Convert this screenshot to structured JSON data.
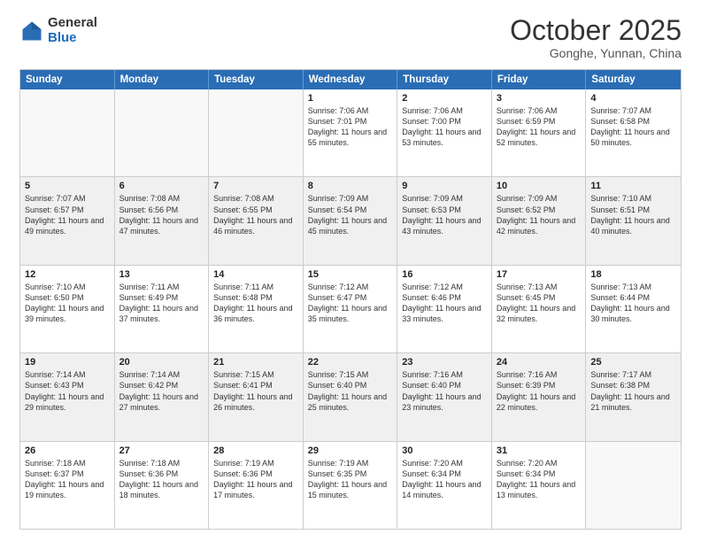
{
  "header": {
    "logo_general": "General",
    "logo_blue": "Blue",
    "month_title": "October 2025",
    "location": "Gonghe, Yunnan, China"
  },
  "days_of_week": [
    "Sunday",
    "Monday",
    "Tuesday",
    "Wednesday",
    "Thursday",
    "Friday",
    "Saturday"
  ],
  "rows": [
    [
      {
        "day": "",
        "info": ""
      },
      {
        "day": "",
        "info": ""
      },
      {
        "day": "",
        "info": ""
      },
      {
        "day": "1",
        "info": "Sunrise: 7:06 AM\nSunset: 7:01 PM\nDaylight: 11 hours and 55 minutes."
      },
      {
        "day": "2",
        "info": "Sunrise: 7:06 AM\nSunset: 7:00 PM\nDaylight: 11 hours and 53 minutes."
      },
      {
        "day": "3",
        "info": "Sunrise: 7:06 AM\nSunset: 6:59 PM\nDaylight: 11 hours and 52 minutes."
      },
      {
        "day": "4",
        "info": "Sunrise: 7:07 AM\nSunset: 6:58 PM\nDaylight: 11 hours and 50 minutes."
      }
    ],
    [
      {
        "day": "5",
        "info": "Sunrise: 7:07 AM\nSunset: 6:57 PM\nDaylight: 11 hours and 49 minutes."
      },
      {
        "day": "6",
        "info": "Sunrise: 7:08 AM\nSunset: 6:56 PM\nDaylight: 11 hours and 47 minutes."
      },
      {
        "day": "7",
        "info": "Sunrise: 7:08 AM\nSunset: 6:55 PM\nDaylight: 11 hours and 46 minutes."
      },
      {
        "day": "8",
        "info": "Sunrise: 7:09 AM\nSunset: 6:54 PM\nDaylight: 11 hours and 45 minutes."
      },
      {
        "day": "9",
        "info": "Sunrise: 7:09 AM\nSunset: 6:53 PM\nDaylight: 11 hours and 43 minutes."
      },
      {
        "day": "10",
        "info": "Sunrise: 7:09 AM\nSunset: 6:52 PM\nDaylight: 11 hours and 42 minutes."
      },
      {
        "day": "11",
        "info": "Sunrise: 7:10 AM\nSunset: 6:51 PM\nDaylight: 11 hours and 40 minutes."
      }
    ],
    [
      {
        "day": "12",
        "info": "Sunrise: 7:10 AM\nSunset: 6:50 PM\nDaylight: 11 hours and 39 minutes."
      },
      {
        "day": "13",
        "info": "Sunrise: 7:11 AM\nSunset: 6:49 PM\nDaylight: 11 hours and 37 minutes."
      },
      {
        "day": "14",
        "info": "Sunrise: 7:11 AM\nSunset: 6:48 PM\nDaylight: 11 hours and 36 minutes."
      },
      {
        "day": "15",
        "info": "Sunrise: 7:12 AM\nSunset: 6:47 PM\nDaylight: 11 hours and 35 minutes."
      },
      {
        "day": "16",
        "info": "Sunrise: 7:12 AM\nSunset: 6:46 PM\nDaylight: 11 hours and 33 minutes."
      },
      {
        "day": "17",
        "info": "Sunrise: 7:13 AM\nSunset: 6:45 PM\nDaylight: 11 hours and 32 minutes."
      },
      {
        "day": "18",
        "info": "Sunrise: 7:13 AM\nSunset: 6:44 PM\nDaylight: 11 hours and 30 minutes."
      }
    ],
    [
      {
        "day": "19",
        "info": "Sunrise: 7:14 AM\nSunset: 6:43 PM\nDaylight: 11 hours and 29 minutes."
      },
      {
        "day": "20",
        "info": "Sunrise: 7:14 AM\nSunset: 6:42 PM\nDaylight: 11 hours and 27 minutes."
      },
      {
        "day": "21",
        "info": "Sunrise: 7:15 AM\nSunset: 6:41 PM\nDaylight: 11 hours and 26 minutes."
      },
      {
        "day": "22",
        "info": "Sunrise: 7:15 AM\nSunset: 6:40 PM\nDaylight: 11 hours and 25 minutes."
      },
      {
        "day": "23",
        "info": "Sunrise: 7:16 AM\nSunset: 6:40 PM\nDaylight: 11 hours and 23 minutes."
      },
      {
        "day": "24",
        "info": "Sunrise: 7:16 AM\nSunset: 6:39 PM\nDaylight: 11 hours and 22 minutes."
      },
      {
        "day": "25",
        "info": "Sunrise: 7:17 AM\nSunset: 6:38 PM\nDaylight: 11 hours and 21 minutes."
      }
    ],
    [
      {
        "day": "26",
        "info": "Sunrise: 7:18 AM\nSunset: 6:37 PM\nDaylight: 11 hours and 19 minutes."
      },
      {
        "day": "27",
        "info": "Sunrise: 7:18 AM\nSunset: 6:36 PM\nDaylight: 11 hours and 18 minutes."
      },
      {
        "day": "28",
        "info": "Sunrise: 7:19 AM\nSunset: 6:36 PM\nDaylight: 11 hours and 17 minutes."
      },
      {
        "day": "29",
        "info": "Sunrise: 7:19 AM\nSunset: 6:35 PM\nDaylight: 11 hours and 15 minutes."
      },
      {
        "day": "30",
        "info": "Sunrise: 7:20 AM\nSunset: 6:34 PM\nDaylight: 11 hours and 14 minutes."
      },
      {
        "day": "31",
        "info": "Sunrise: 7:20 AM\nSunset: 6:34 PM\nDaylight: 11 hours and 13 minutes."
      },
      {
        "day": "",
        "info": ""
      }
    ]
  ]
}
